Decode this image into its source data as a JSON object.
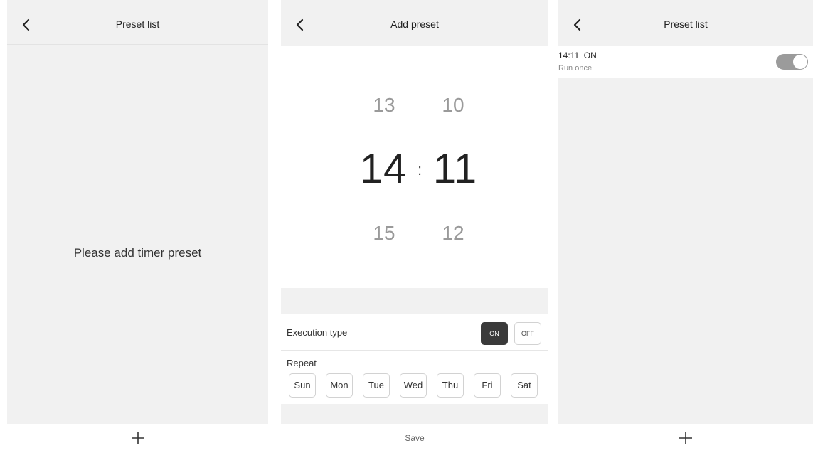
{
  "screens": {
    "empty_list": {
      "title": "Preset list",
      "empty_message": "Please add timer preset",
      "add_icon": "plus-icon",
      "back_icon": "chevron-left-icon"
    },
    "add_preset": {
      "title": "Add preset",
      "back_icon": "chevron-left-icon",
      "time_picker": {
        "hour_prev": "13",
        "hour_selected": "14",
        "hour_next": "15",
        "separator": ":",
        "minute_prev": "10",
        "minute_selected": "11",
        "minute_next": "12"
      },
      "execution_type": {
        "label": "Execution type",
        "on_label": "ON",
        "off_label": "OFF",
        "selected": "ON"
      },
      "repeat": {
        "label": "Repeat",
        "days": [
          "Sun",
          "Mon",
          "Tue",
          "Wed",
          "Thu",
          "Fri",
          "Sat"
        ]
      },
      "save_label": "Save"
    },
    "preset_list": {
      "title": "Preset list",
      "back_icon": "chevron-left-icon",
      "items": [
        {
          "time_action": "14:11  ON",
          "schedule": "Run once",
          "enabled": true
        }
      ],
      "add_icon": "plus-icon"
    }
  },
  "colors": {
    "panel_bg": "#f1f1f1",
    "exec_on_bg": "#3a3a3a",
    "toggle_bg": "#9b9b9b"
  }
}
